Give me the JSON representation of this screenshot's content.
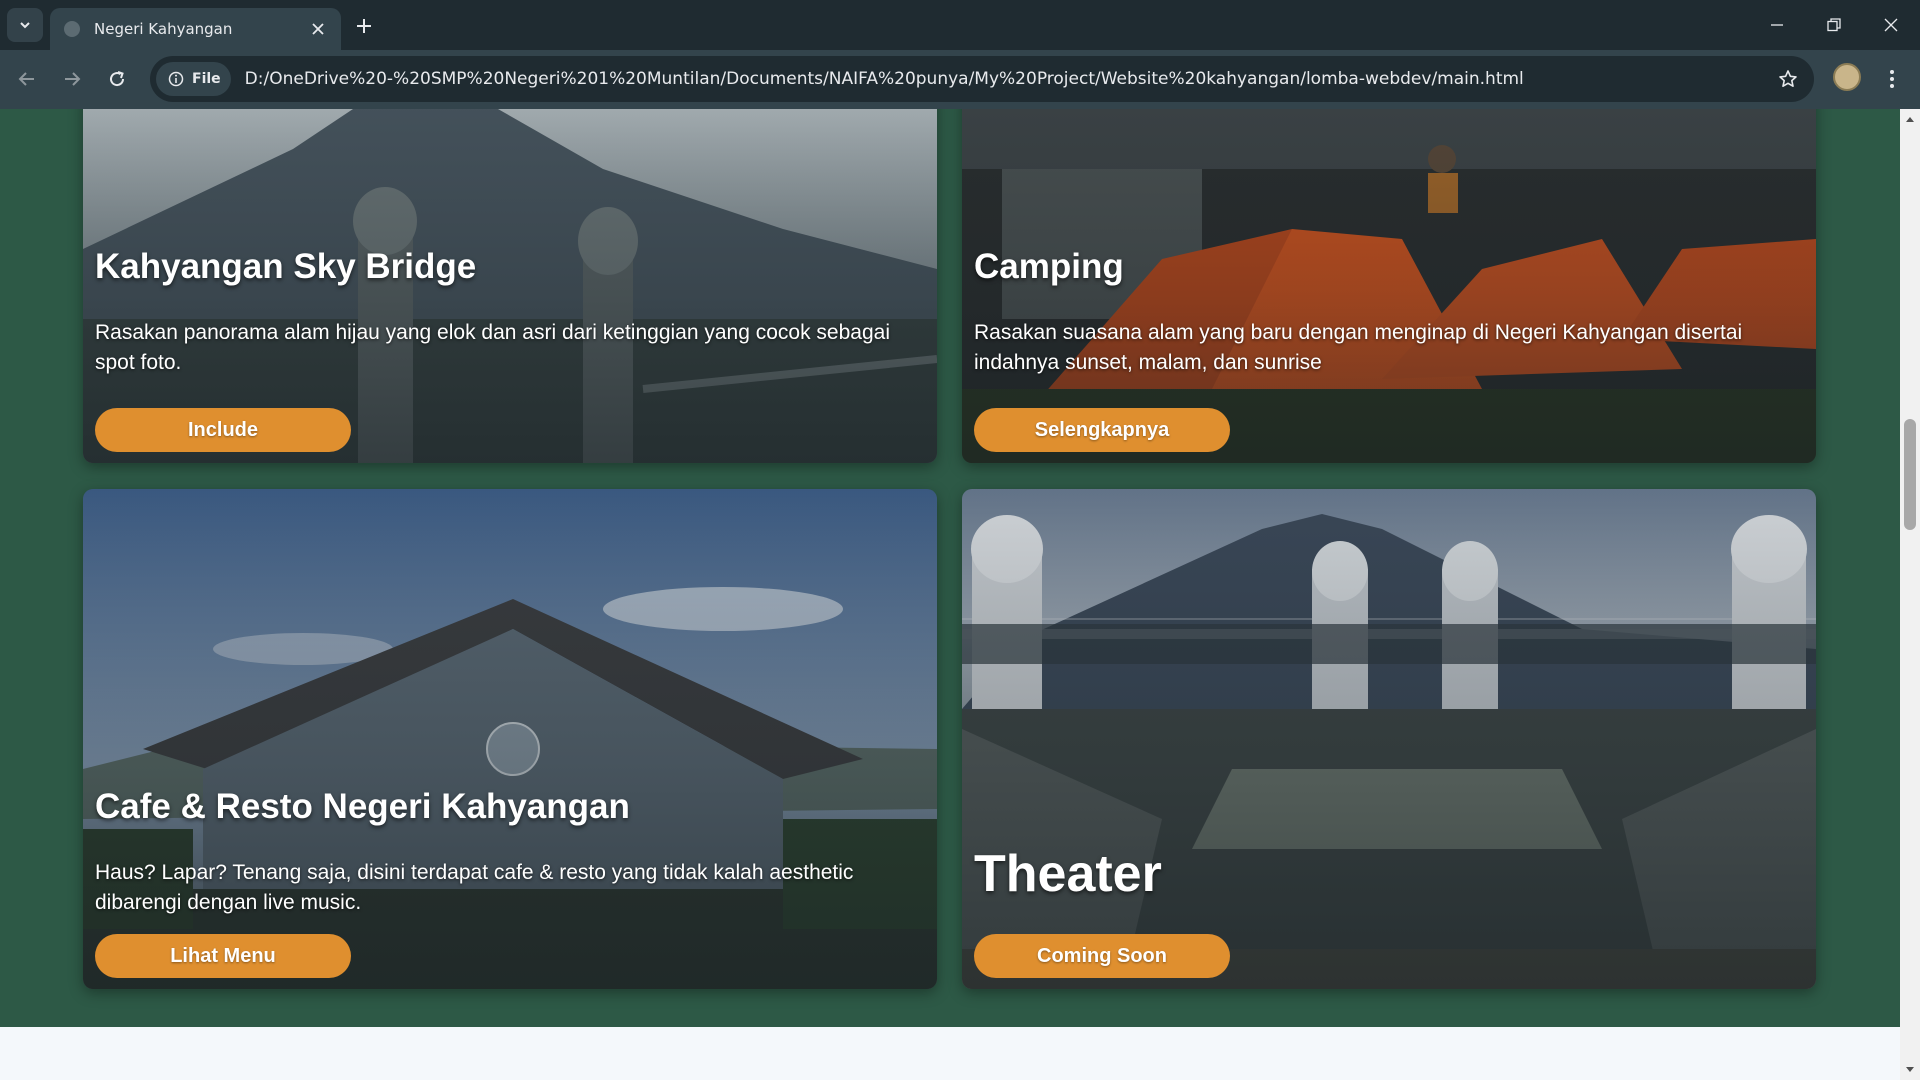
{
  "browser": {
    "tab_title": "Negeri Kahyangan",
    "site_chip_label": "File",
    "url": "D:/OneDrive%20-%20SMP%20Negeri%201%20Muntilan/Documents/NAIFA%20punya/My%20Project/Website%20kahyangan/lomba-webdev/main.html"
  },
  "icons": {
    "tab_search": "chevron-down-icon",
    "favicon": "globe-icon",
    "close": "close-icon",
    "new_tab": "plus-icon",
    "back": "arrow-left-icon",
    "forward": "arrow-right-icon",
    "reload": "reload-icon",
    "info": "info-icon",
    "bookmark": "star-icon",
    "menu": "kebab-menu-icon"
  },
  "cards": [
    {
      "title": "Kahyangan Sky Bridge",
      "description": "Rasakan panorama alam hijau yang elok dan asri dari ketinggian yang cocok sebagai spot foto.",
      "button": "Include"
    },
    {
      "title": "Camping",
      "description": "Rasakan suasana alam yang baru dengan menginap di Negeri Kahyangan disertai indahnya sunset, malam, dan sunrise",
      "button": "Selengkapnya"
    },
    {
      "title": "Cafe & Resto Negeri Kahyangan",
      "description": "Haus? Lapar? Tenang saja, disini terdapat cafe & resto yang tidak kalah aesthetic dibarengi dengan live music.",
      "button": "Lihat Menu"
    },
    {
      "title": "Theater",
      "description": "",
      "button": "Coming Soon"
    }
  ],
  "colors": {
    "page_background": "#2d5946",
    "button": "#df8f2f",
    "footer": "#f4f8fb"
  }
}
